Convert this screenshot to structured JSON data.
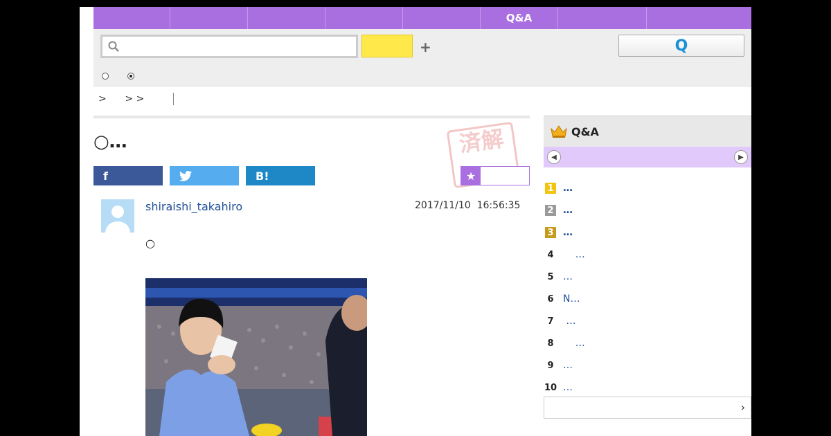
{
  "nav": {
    "items": [
      "",
      "",
      "",
      "",
      "",
      "Q&A",
      "",
      ""
    ]
  },
  "search": {
    "placeholder": "",
    "button_label": "",
    "plus_label": "+",
    "question_button_label": "Q"
  },
  "breadcrumb": {
    "text": ">      > >  "
  },
  "question": {
    "title": "○…",
    "stamp_text": "済解",
    "share": {
      "facebook_label": "f",
      "twitter_label": "🐦",
      "hatena_label": "B!"
    },
    "author": "shiraishi_takahiro",
    "date": "2017/11/10  16:56:35",
    "body": "○"
  },
  "sidebar": {
    "title": "Q&A",
    "ranking": [
      {
        "rank": "1",
        "text": "…",
        "bold": true,
        "badge_color": "#f1c40f"
      },
      {
        "rank": "2",
        "text": "…",
        "bold": true,
        "badge_color": "#9a9a9a"
      },
      {
        "rank": "3",
        "text": "…",
        "bold": true,
        "badge_color": "#c69b1b"
      },
      {
        "rank": "4",
        "text": "    …",
        "bold": false
      },
      {
        "rank": "5",
        "text": "…",
        "bold": false
      },
      {
        "rank": "6",
        "text": "N…",
        "bold": false
      },
      {
        "rank": "7",
        "text": " …",
        "bold": false
      },
      {
        "rank": "8",
        "text": "    …",
        "bold": false
      },
      {
        "rank": "9",
        "text": "…",
        "bold": false
      },
      {
        "rank": "10",
        "text": "…",
        "bold": false
      }
    ],
    "more_arrow": "›"
  },
  "colors": {
    "nav": "#a96ee0",
    "search_button": "#ffe94a",
    "tab_bar": "#e1c9fb",
    "link": "#1f4f99"
  }
}
